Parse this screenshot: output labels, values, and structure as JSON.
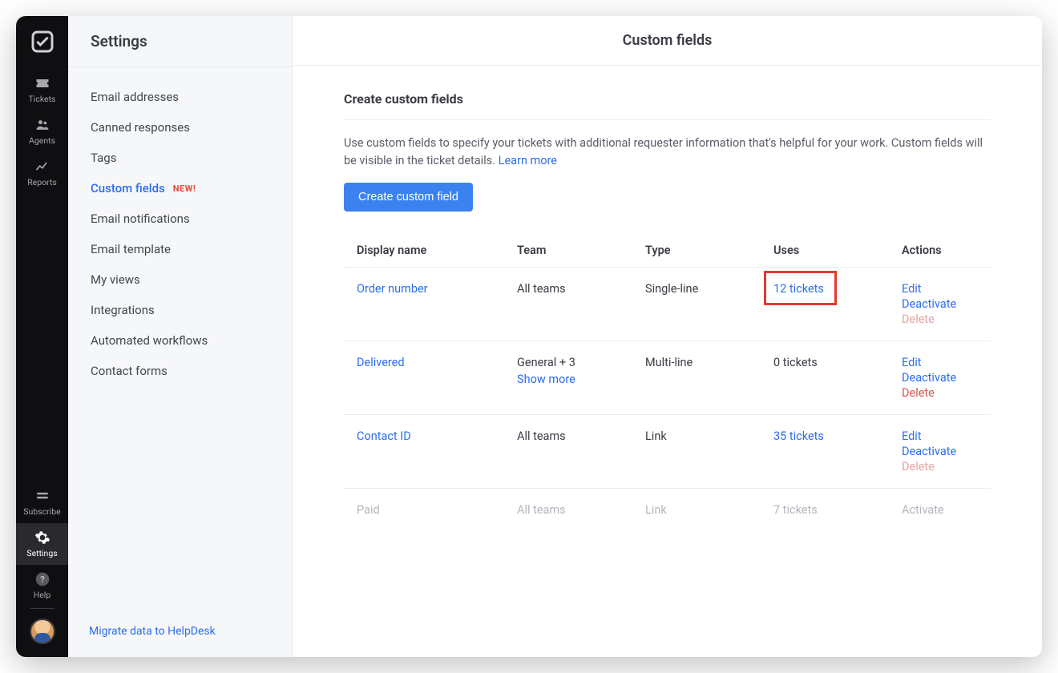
{
  "rail": {
    "items": [
      {
        "key": "tickets",
        "label": "Tickets"
      },
      {
        "key": "agents",
        "label": "Agents"
      },
      {
        "key": "reports",
        "label": "Reports"
      }
    ],
    "bottom": [
      {
        "key": "subscribe",
        "label": "Subscribe"
      },
      {
        "key": "settings",
        "label": "Settings",
        "active": true
      },
      {
        "key": "help",
        "label": "Help"
      }
    ]
  },
  "sidebar": {
    "title": "Settings",
    "items": [
      {
        "label": "Email addresses"
      },
      {
        "label": "Canned responses"
      },
      {
        "label": "Tags"
      },
      {
        "label": "Custom fields",
        "active": true,
        "badge": "NEW!"
      },
      {
        "label": "Email notifications"
      },
      {
        "label": "Email template"
      },
      {
        "label": "My views"
      },
      {
        "label": "Integrations"
      },
      {
        "label": "Automated workflows"
      },
      {
        "label": "Contact forms"
      }
    ],
    "migrate_label": "Migrate data to HelpDesk"
  },
  "main": {
    "header_title": "Custom fields",
    "section_title": "Create custom fields",
    "description_before": "Use custom fields to specify your tickets with additional requester information that's helpful for your work. Custom fields will be visible in the ticket details. ",
    "learn_more": "Learn more",
    "create_button": "Create custom field",
    "columns": [
      "Display name",
      "Team",
      "Type",
      "Uses",
      "Actions"
    ],
    "action_labels": {
      "edit": "Edit",
      "deactivate": "Deactivate",
      "delete": "Delete",
      "activate": "Activate"
    },
    "show_more": "Show more",
    "rows": [
      {
        "name": "Order number",
        "team": "All teams",
        "type": "Single-line",
        "uses": "12 tickets",
        "uses_link": true,
        "uses_highlight": true,
        "actions": [
          "edit",
          "deactivate",
          "delete"
        ],
        "delete_muted": true,
        "team_show_more": false
      },
      {
        "name": "Delivered",
        "team": "General + 3",
        "type": "Multi-line",
        "uses": "0 tickets",
        "uses_link": false,
        "actions": [
          "edit",
          "deactivate",
          "delete"
        ],
        "delete_muted": false,
        "team_show_more": true
      },
      {
        "name": "Contact ID",
        "team": "All teams",
        "type": "Link",
        "uses": "35 tickets",
        "uses_link": true,
        "actions": [
          "edit",
          "deactivate",
          "delete"
        ],
        "delete_muted": true,
        "team_show_more": false
      },
      {
        "name": "Paid",
        "team": "All teams",
        "type": "Link",
        "uses": "7 tickets",
        "uses_link": true,
        "actions": [
          "activate"
        ],
        "muted": true,
        "team_show_more": false
      }
    ]
  }
}
